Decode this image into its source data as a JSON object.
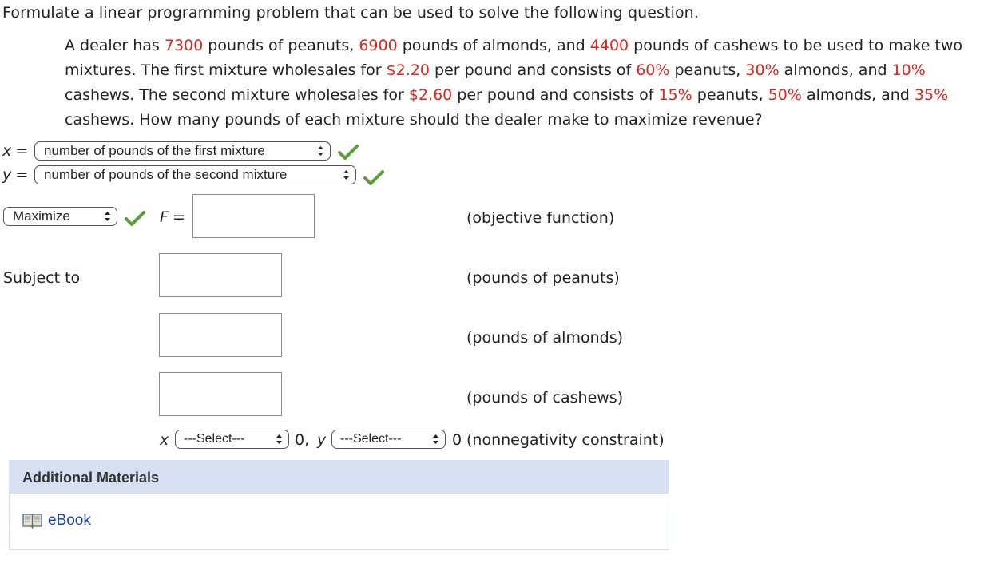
{
  "instruction": "Formulate a linear programming problem that can be used to solve the following question.",
  "problem": {
    "s1": "A dealer has ",
    "peanuts_lbs": "7300",
    "s2": " pounds of peanuts, ",
    "almonds_lbs": "6900",
    "s3": " pounds of almonds, and ",
    "cashews_lbs": "4400",
    "s4": " pounds of cashews to be used to make two mixtures. The first mixture wholesales for ",
    "price1": "$2.20",
    "s5": " per pound and consists of ",
    "m1_peanuts": "60%",
    "s6": " peanuts, ",
    "m1_almonds": "30%",
    "s7": " almonds, and ",
    "m1_cashews": "10%",
    "s8": " cashews. The second mixture wholesales for ",
    "price2": "$2.60",
    "s9": " per pound and consists of ",
    "m2_peanuts": "15%",
    "s10": " peanuts, ",
    "m2_almonds": "50%",
    "s11": " almonds, and ",
    "m2_cashews": "35%",
    "s12": " cashews. How many pounds of each mixture should the dealer make to maximize revenue?"
  },
  "variables": {
    "x_symbol": "x",
    "y_symbol": "y",
    "equals": "=",
    "x_definition": "number of pounds of the first mixture",
    "y_definition": "number of pounds of the second mixture"
  },
  "objective": {
    "type_selected": "Maximize",
    "f_label": "F",
    "equals": "=",
    "value": "",
    "note": "(objective function)"
  },
  "constraints": {
    "subject_to": "Subject to",
    "peanuts_note": "(pounds of peanuts)",
    "almonds_note": "(pounds of almonds)",
    "cashews_note": "(pounds of cashews)",
    "peanuts_value": "",
    "almonds_value": "",
    "cashews_value": ""
  },
  "nonnegativity": {
    "x_symbol": "x",
    "y_symbol": "y",
    "x_select": "---Select---",
    "y_select": "---Select---",
    "zero_comma": "0,",
    "zero": "0",
    "note": "(nonnegativity constraint)"
  },
  "additional_materials": {
    "title": "Additional Materials",
    "ebook": "eBook"
  },
  "colors": {
    "highlight_red": "#e0241b",
    "check_green": "#5a9e3a",
    "materials_header": "#d7dff2",
    "link_blue": "#1a3fb0"
  }
}
